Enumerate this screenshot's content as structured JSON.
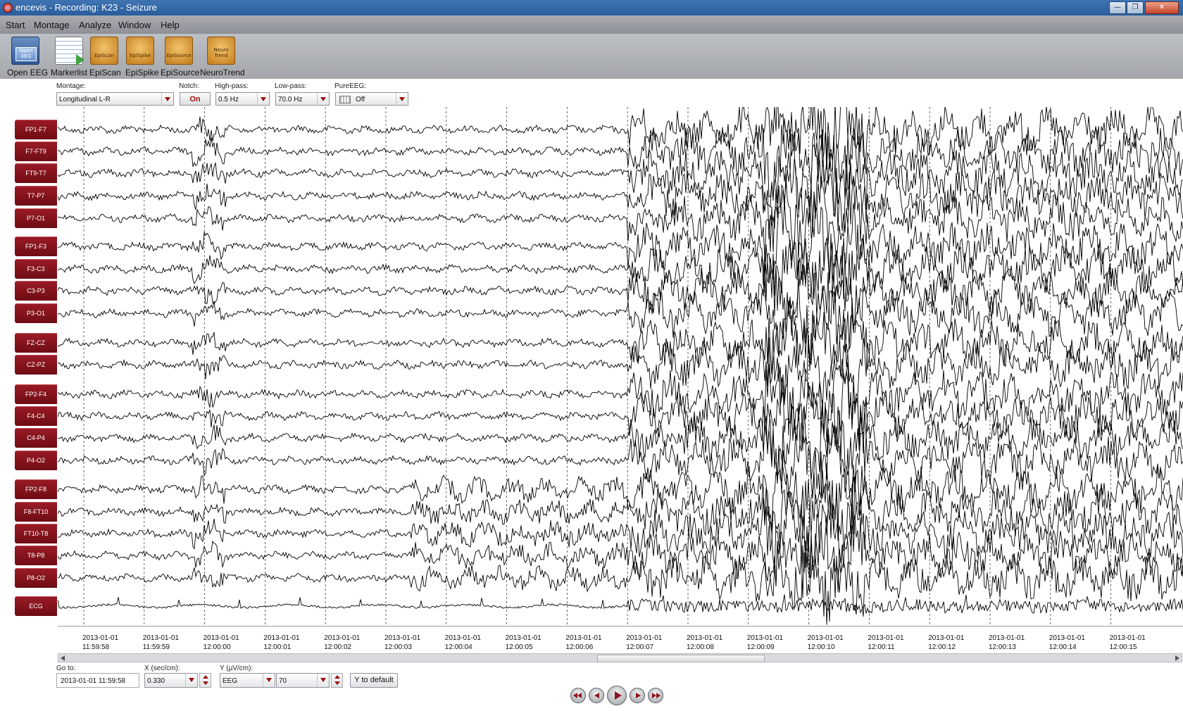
{
  "window": {
    "title": "encevis - Recording: K23 - Seizure",
    "controls": [
      "minimize",
      "maximize",
      "close"
    ]
  },
  "menu": [
    "Start",
    "Montage",
    "Analyze",
    "Window",
    "Help"
  ],
  "toolbar": [
    {
      "label": "Open EEG",
      "icon": "open-eeg-icon",
      "icon_text": "Open EEG"
    },
    {
      "label": "Markerlist",
      "icon": "markerlist-icon",
      "icon_text": ""
    },
    {
      "label": "EpiScan",
      "icon": "episcan-icon",
      "icon_text": "EpiScan"
    },
    {
      "label": "EpiSpike",
      "icon": "epispike-icon",
      "icon_text": "EpiSpike"
    },
    {
      "label": "EpiSource",
      "icon": "episource-icon",
      "icon_text": "EpiSource"
    },
    {
      "label": "NeuroTrend",
      "icon": "neurotrend-icon",
      "icon_text": "Neuro Trend"
    }
  ],
  "filters": {
    "montage_label": "Montage:",
    "montage_value": "Longitudinal L-R",
    "notch_label": "Notch:",
    "notch_value": "On",
    "highpass_label": "High-pass:",
    "highpass_value": "0.5 Hz",
    "lowpass_label": "Low-pass:",
    "lowpass_value": "70.0 Hz",
    "pureeeg_label": "PureEEG:",
    "pureeeg_value": "Off"
  },
  "channels": [
    {
      "name": "FP1-F7",
      "group": 0
    },
    {
      "name": "F7-FT9",
      "group": 0
    },
    {
      "name": "FT9-T7",
      "group": 0
    },
    {
      "name": "T7-P7",
      "group": 0
    },
    {
      "name": "P7-O1",
      "group": 0
    },
    {
      "name": "FP1-F3",
      "group": 1
    },
    {
      "name": "F3-C3",
      "group": 1
    },
    {
      "name": "C3-P3",
      "group": 1
    },
    {
      "name": "P3-O1",
      "group": 1
    },
    {
      "name": "FZ-CZ",
      "group": 2
    },
    {
      "name": "CZ-PZ",
      "group": 2
    },
    {
      "name": "FP2-F4",
      "group": 3
    },
    {
      "name": "F4-C4",
      "group": 3
    },
    {
      "name": "C4-P4",
      "group": 3
    },
    {
      "name": "P4-O2",
      "group": 3
    },
    {
      "name": "FP2-F8",
      "group": 4
    },
    {
      "name": "F8-FT10",
      "group": 4
    },
    {
      "name": "FT10-T8",
      "group": 4
    },
    {
      "name": "T8-P8",
      "group": 4
    },
    {
      "name": "P8-O2",
      "group": 4
    },
    {
      "name": "ECG",
      "group": 5
    }
  ],
  "time_axis": [
    {
      "date": "2013-01-01",
      "time": "11:59:58"
    },
    {
      "date": "2013-01-01",
      "time": "11:59:59"
    },
    {
      "date": "2013-01-01",
      "time": "12:00:00"
    },
    {
      "date": "2013-01-01",
      "time": "12:00:01"
    },
    {
      "date": "2013-01-01",
      "time": "12:00:02"
    },
    {
      "date": "2013-01-01",
      "time": "12:00:03"
    },
    {
      "date": "2013-01-01",
      "time": "12:00:04"
    },
    {
      "date": "2013-01-01",
      "time": "12:00:05"
    },
    {
      "date": "2013-01-01",
      "time": "12:00:06"
    },
    {
      "date": "2013-01-01",
      "time": "12:00:07"
    },
    {
      "date": "2013-01-01",
      "time": "12:00:08"
    },
    {
      "date": "2013-01-01",
      "time": "12:00:09"
    },
    {
      "date": "2013-01-01",
      "time": "12:00:10"
    },
    {
      "date": "2013-01-01",
      "time": "12:00:11"
    },
    {
      "date": "2013-01-01",
      "time": "12:00:12"
    },
    {
      "date": "2013-01-01",
      "time": "12:00:13"
    },
    {
      "date": "2013-01-01",
      "time": "12:00:14"
    },
    {
      "date": "2013-01-01",
      "time": "12:00:15"
    }
  ],
  "seizure_onset_time": "12:00:07",
  "bottom": {
    "goto_label": "Go to:",
    "goto_value": "2013-01-01 11:59:58",
    "x_label": "X (sec/cm):",
    "x_value": "0.330",
    "y_label": "Y (µV/cm):",
    "y_type": "EEG",
    "y_value": "70",
    "y_default_button": "Y to default"
  },
  "playback": [
    "skip-back-icon",
    "step-back-icon",
    "play-icon",
    "step-forward-icon",
    "skip-forward-icon"
  ],
  "colors": {
    "channel_label_bg": "#8b1420",
    "titlebar": "#2a5d9b",
    "trace": "#000000"
  }
}
